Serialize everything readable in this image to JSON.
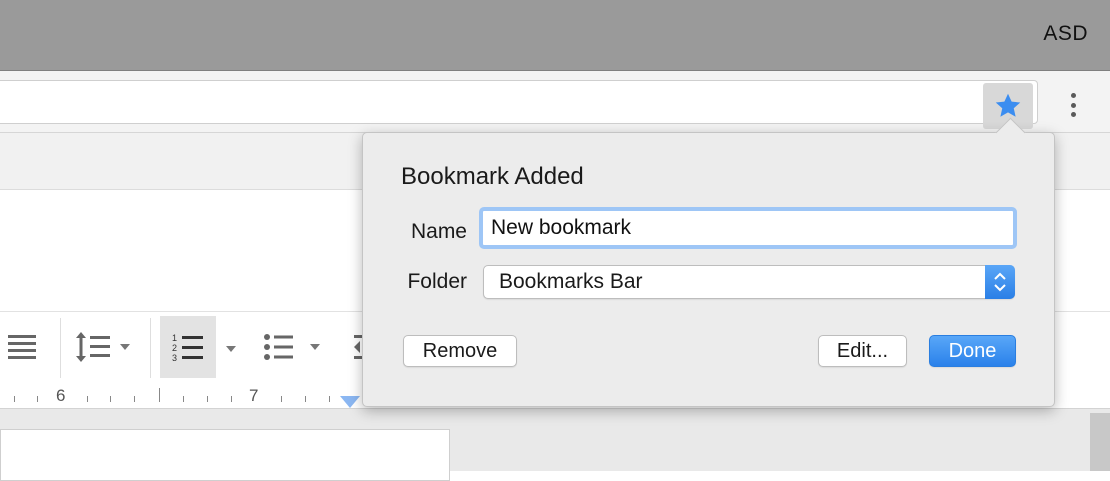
{
  "window": {
    "profile_name": "ASD"
  },
  "toolbar": {
    "bookmark_star_icon": "star-icon",
    "menu_icon": "vertical-dots-icon",
    "star_color": "#3b8df0"
  },
  "formatting": {
    "icons": [
      "align-justify-icon",
      "line-spacing-icon",
      "numbered-list-icon",
      "bulleted-list-icon",
      "decrease-indent-icon"
    ],
    "active": "numbered-list-icon"
  },
  "ruler": {
    "labels": [
      "6",
      "7"
    ]
  },
  "bookmark_popup": {
    "title": "Bookmark Added",
    "name_label": "Name",
    "name_value": "New bookmark",
    "folder_label": "Folder",
    "folder_value": "Bookmarks Bar",
    "remove_label": "Remove",
    "edit_label": "Edit...",
    "done_label": "Done",
    "accent_color": "#2a81ea"
  }
}
